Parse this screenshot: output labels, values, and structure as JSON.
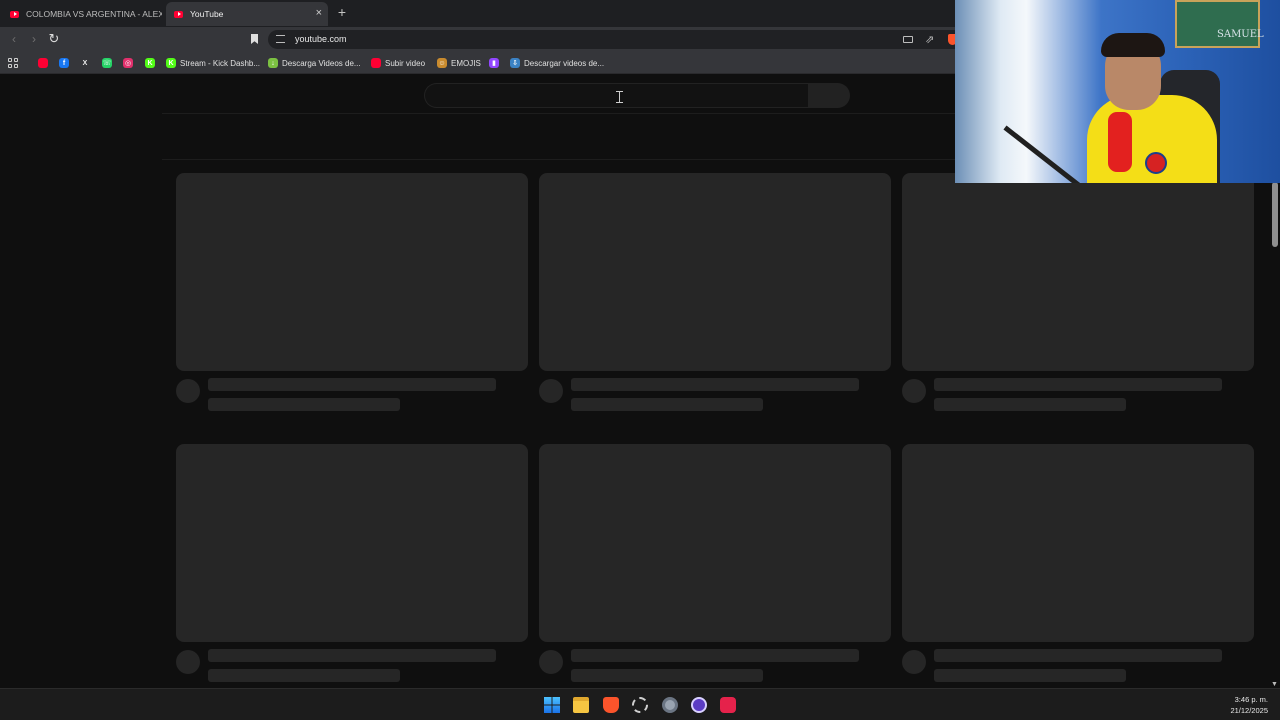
{
  "browser": {
    "tabs": [
      {
        "label": "COLOMBIA VS ARGENTINA - ALEXD",
        "active": false
      },
      {
        "label": "YouTube",
        "active": true
      }
    ],
    "new_tab_label": "+",
    "close_label": "×",
    "back_label": "‹",
    "forward_label": "›",
    "reload_label": "↻",
    "share_label": "⇗",
    "address": "youtube.com"
  },
  "bookmarks": [
    {
      "label": "",
      "icon": "youtube-icon",
      "color": "#ff0033"
    },
    {
      "label": "",
      "icon": "facebook-icon",
      "color": "#1877f2",
      "glyph": "f"
    },
    {
      "label": "",
      "icon": "x-icon",
      "color": "#000000",
      "glyph": "X"
    },
    {
      "label": "",
      "icon": "whatsapp-icon",
      "color": "#25d366",
      "glyph": "☏"
    },
    {
      "label": "",
      "icon": "instagram-icon",
      "color": "#e1306c",
      "glyph": "◎"
    },
    {
      "label": "",
      "icon": "kick-icon",
      "color": "#53fc18",
      "glyph": "K"
    },
    {
      "label": "Stream - Kick Dashb...",
      "icon": "kick-icon",
      "color": "#53fc18",
      "glyph": "K"
    },
    {
      "label": "Descarga Videos de...",
      "icon": "download-icon",
      "color": "#7cc142",
      "glyph": "↓"
    },
    {
      "label": "Subir video",
      "icon": "youtube-icon",
      "color": "#ff0033",
      "glyph": ""
    },
    {
      "label": "EMOJIS",
      "icon": "emoji-icon",
      "color": "#c98b2e",
      "glyph": "☺"
    },
    {
      "label": "",
      "icon": "twitch-icon",
      "color": "#9146ff",
      "glyph": "▮"
    },
    {
      "label": "Descargar videos de...",
      "icon": "download-box-icon",
      "color": "#3b82c4",
      "glyph": "⇩"
    }
  ],
  "search": {
    "placeholder": "",
    "value": ""
  },
  "taskbar": {
    "icons": [
      "windows-start-icon",
      "file-explorer-icon",
      "brave-icon",
      "app-icon",
      "settings-icon",
      "obs-icon",
      "tiktok-icon"
    ],
    "time": "3:46 p. m.",
    "date": "21/12/2025"
  },
  "webcam": {
    "wall_text": "SAMUEL"
  },
  "colors": {
    "background": "#0f0f0f",
    "skeleton": "#262626",
    "accent": "#ff0033"
  }
}
